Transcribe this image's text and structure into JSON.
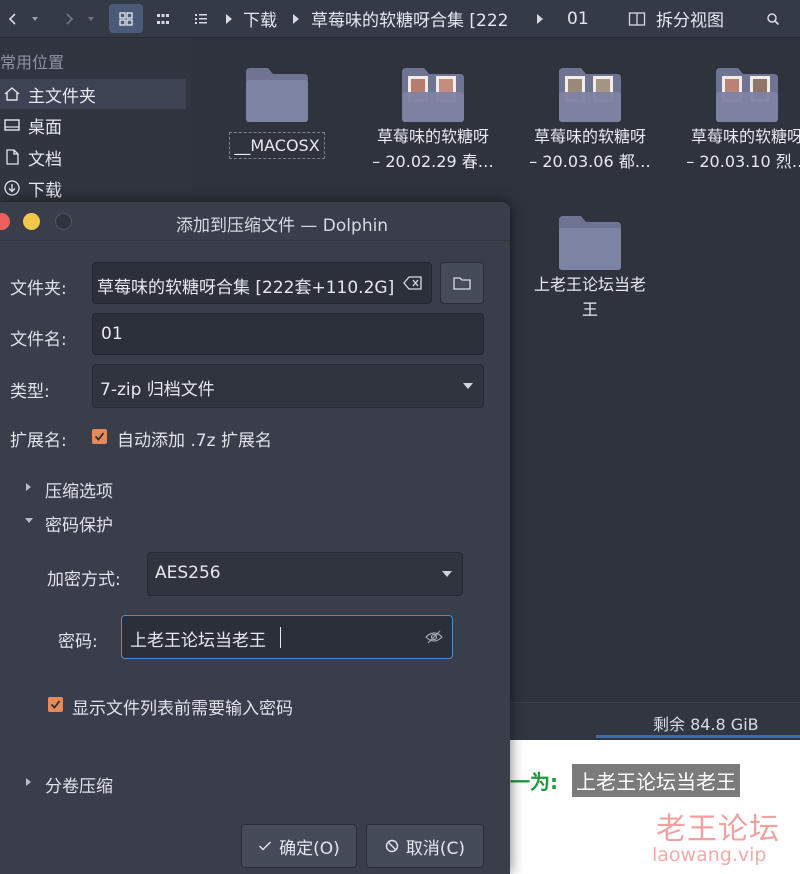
{
  "toolbar": {
    "breadcrumb": [
      "下载",
      "草莓味的软糖呀合集 [222",
      "01"
    ],
    "split_view_label": "拆分视图"
  },
  "sidebar": {
    "heading": "常用位置",
    "items": [
      {
        "label": "主文件夹",
        "icon": "home-icon",
        "selected": true
      },
      {
        "label": "桌面",
        "icon": "desktop-icon"
      },
      {
        "label": "文档",
        "icon": "document-icon"
      },
      {
        "label": "下载",
        "icon": "download-icon"
      }
    ]
  },
  "files": [
    {
      "line1": "__MACOSX",
      "line2": "",
      "thumb": false
    },
    {
      "line1": "草莓味的软糖呀",
      "line2": "– 20.02.29 春…",
      "thumb": true
    },
    {
      "line1": "草莓味的软糖呀",
      "line2": "– 20.03.06 都…",
      "thumb": true
    },
    {
      "line1": "草莓味的软糖呀",
      "line2": "– 20.03.10 烈…",
      "thumb": true
    },
    {
      "line1": "上老王论坛当老",
      "line2": "王",
      "thumb": false
    }
  ],
  "statusbar": {
    "free_space": "剩余 84.8 GiB",
    "usage_fraction": 1.0
  },
  "web_overlay": {
    "label": "一为:",
    "password_text": "上老王论坛当老王",
    "watermark_title": "老王论坛",
    "watermark_url": "laowang.vip"
  },
  "dialog": {
    "title": "添加到压缩文件 — Dolphin",
    "folder_label": "文件夹:",
    "folder_value": "草莓味的软糖呀合集 [222套+110.2G]",
    "filename_label": "文件名:",
    "filename_value": "01",
    "type_label": "类型:",
    "type_value": "7-zip 归档文件",
    "ext_label": "扩展名:",
    "ext_checkbox_label": "自动添加 .7z 扩展名",
    "ext_checked": true,
    "compression_section": "压缩选项",
    "password_section": "密码保护",
    "encryption_label": "加密方式:",
    "encryption_value": "AES256",
    "password_label": "密码:",
    "password_value": "上老王论坛当老王",
    "list_password_label": "显示文件列表前需要输入密码",
    "list_password_checked": true,
    "split_section": "分卷压缩",
    "ok_label": "确定(O)",
    "cancel_label": "取消(C)"
  },
  "colors": {
    "accent": "#4b5a76",
    "checkbox": "#e58a5a",
    "close_button": "#ec5f5b",
    "minimize_button": "#f2c94c",
    "focus_border": "#4d8ec9",
    "web_green": "#1d9b3c"
  }
}
